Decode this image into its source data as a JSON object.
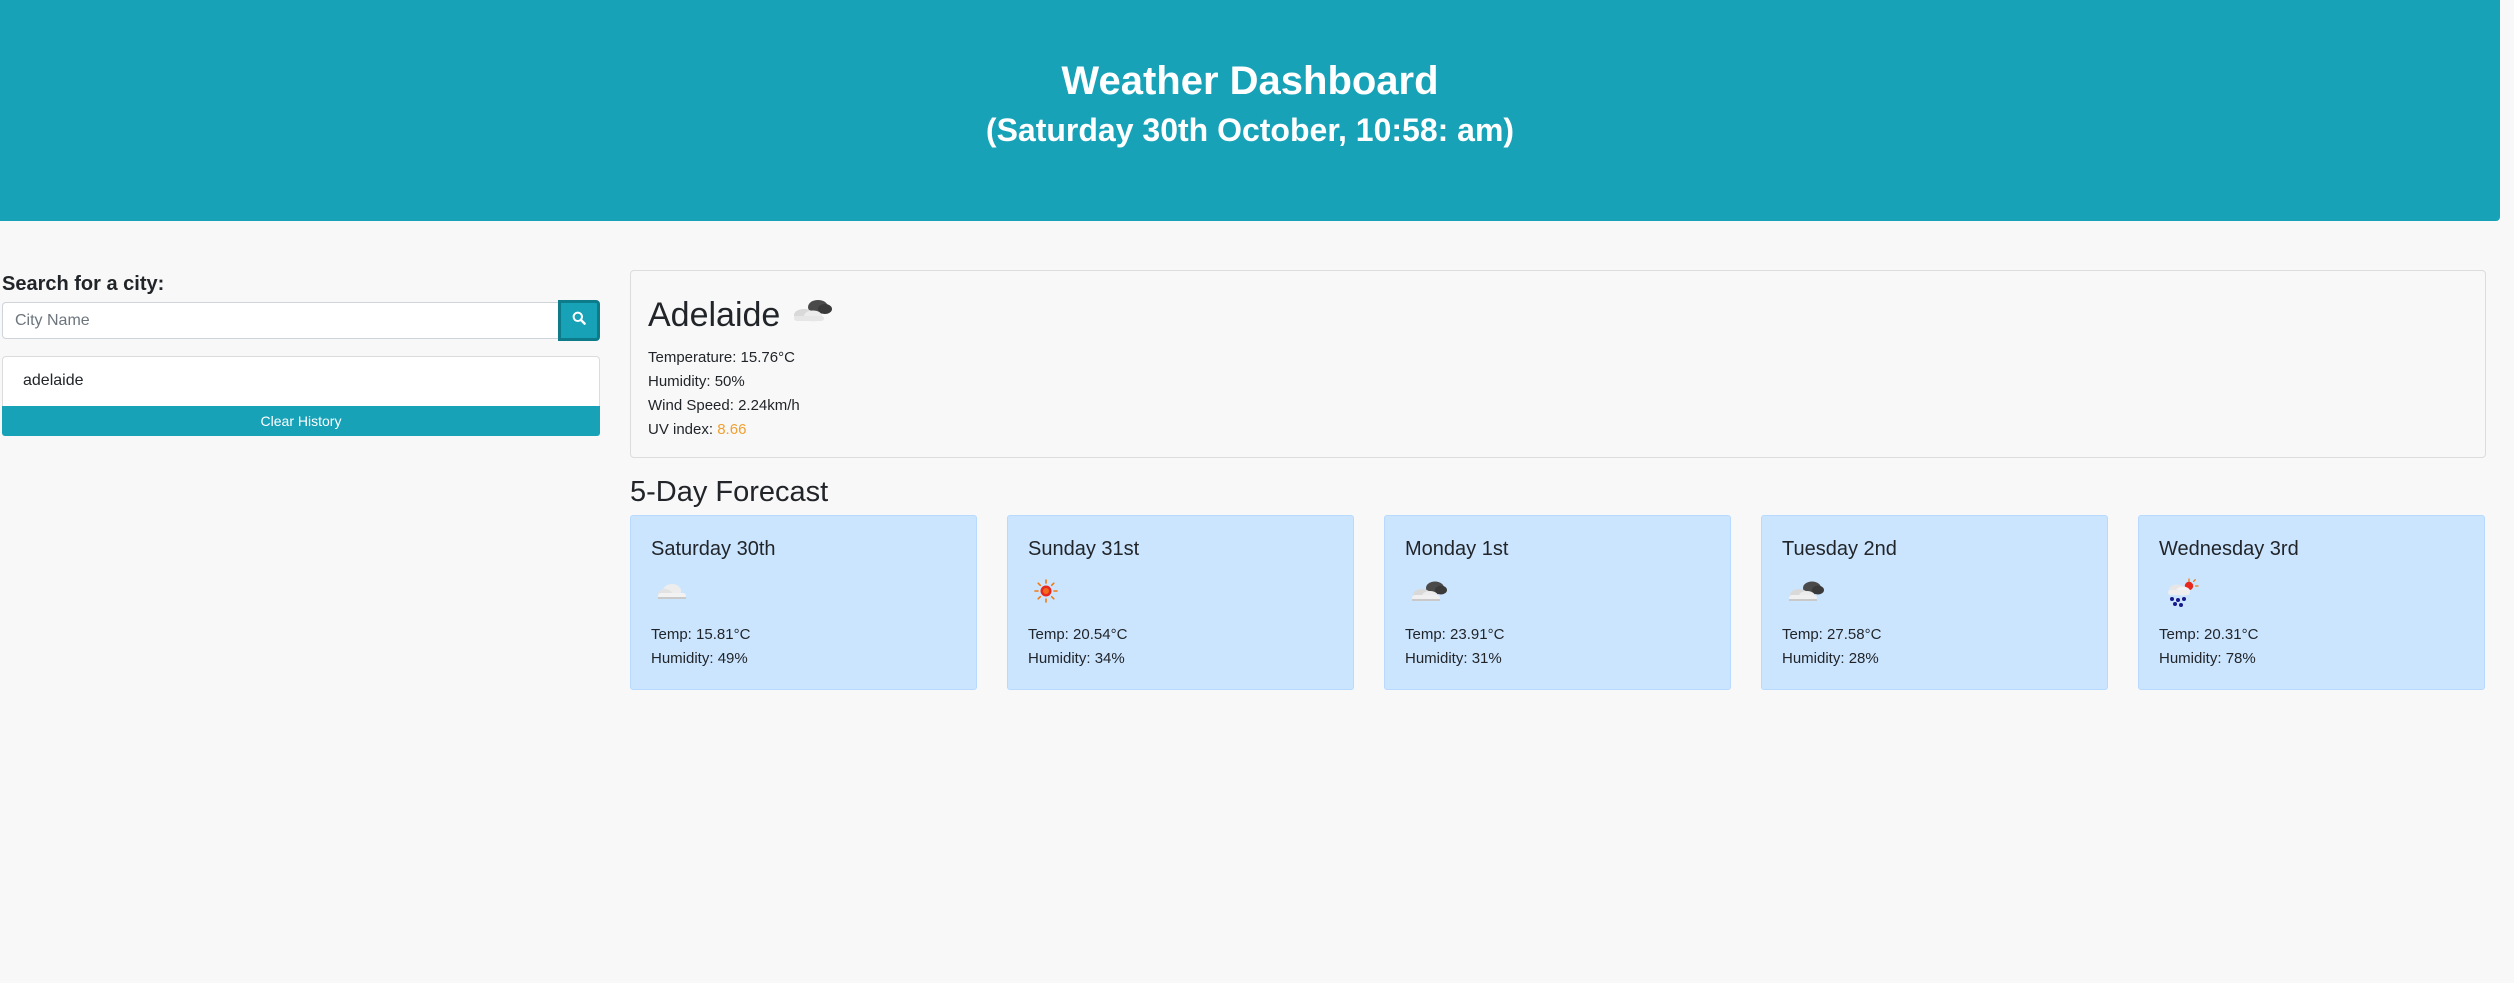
{
  "header": {
    "title": "Weather Dashboard",
    "datetime": "(Saturday 30th October, 10:58: am)"
  },
  "search": {
    "label": "Search for a city:",
    "placeholder": "City Name",
    "value": "",
    "button_icon": "search-icon"
  },
  "history": {
    "items": [
      "adelaide"
    ],
    "clear_label": "Clear History"
  },
  "current": {
    "city": "Adelaide",
    "icon": "broken-clouds-icon",
    "temperature_label": "Temperature:",
    "temperature": "15.76°C",
    "humidity_label": "Humidity:",
    "humidity": "50%",
    "wind_label": "Wind Speed:",
    "wind": "2.24km/h",
    "uv_label": "UV index:",
    "uv": "8.66",
    "uv_color": "#f0a030"
  },
  "forecast": {
    "title": "5-Day Forecast",
    "temp_label": "Temp:",
    "humidity_label": "Humidity:",
    "days": [
      {
        "day": "Saturday 30th",
        "icon": "few-clouds-icon",
        "temp": "15.81°C",
        "humidity": "49%"
      },
      {
        "day": "Sunday 31st",
        "icon": "clear-sun-icon",
        "temp": "20.54°C",
        "humidity": "34%"
      },
      {
        "day": "Monday 1st",
        "icon": "broken-clouds-icon",
        "temp": "23.91°C",
        "humidity": "31%"
      },
      {
        "day": "Tuesday 2nd",
        "icon": "broken-clouds-icon",
        "temp": "27.58°C",
        "humidity": "28%"
      },
      {
        "day": "Wednesday 3rd",
        "icon": "rain-sun-icon",
        "temp": "20.31°C",
        "humidity": "78%"
      }
    ]
  },
  "colors": {
    "accent": "#17a2b8",
    "card_bg": "#cce5ff",
    "page_bg": "#f8f8f8"
  }
}
